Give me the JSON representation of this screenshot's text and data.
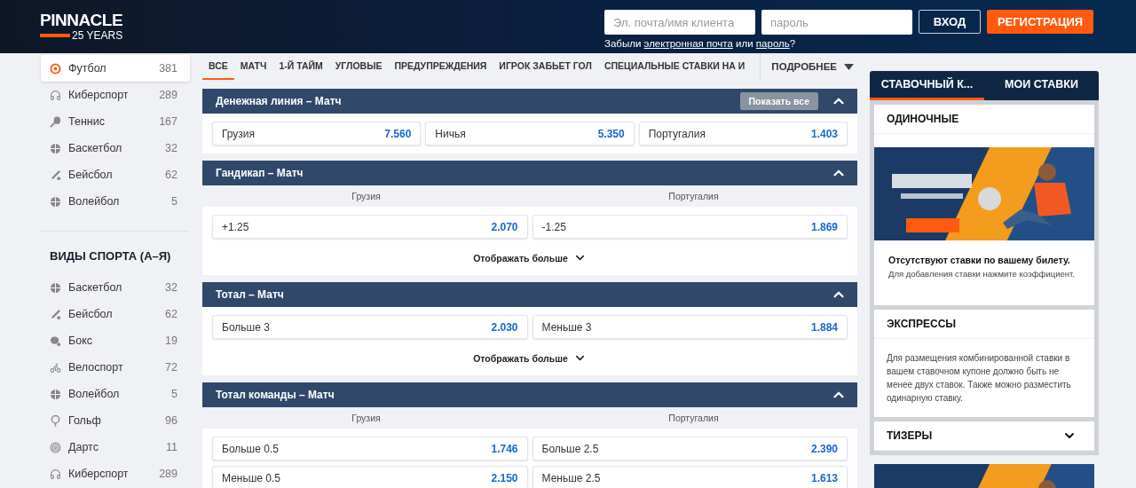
{
  "header": {
    "logo": {
      "brand": "PINNACLE",
      "tagline": "25 YEARS"
    },
    "login_field": {
      "placeholder": "Эл. почта/имя клиента"
    },
    "password_field": {
      "placeholder": "пароль"
    },
    "login_button": "ВХОД",
    "register_button": "РЕГИСТРАЦИЯ",
    "forgot": {
      "before": "Забыли",
      "link1": "электронная почта",
      "middle": "или",
      "link2": "пароль",
      "after": "?"
    }
  },
  "sidebar": {
    "top_sports": [
      {
        "kind": "football",
        "label": "Футбол",
        "count": "381",
        "selected": true
      },
      {
        "kind": "esports",
        "label": "Киберспорт",
        "count": "289",
        "selected": false
      },
      {
        "kind": "tennis",
        "label": "Теннис",
        "count": "167",
        "selected": false
      },
      {
        "kind": "basketball",
        "label": "Баскетбол",
        "count": "32",
        "selected": false
      },
      {
        "kind": "baseball",
        "label": "Бейсбол",
        "count": "62",
        "selected": false
      },
      {
        "kind": "volleyball",
        "label": "Волейбол",
        "count": "5",
        "selected": false
      }
    ],
    "az_title": "ВИДЫ СПОРТА (А–Я)",
    "az_sports": [
      {
        "kind": "basketball",
        "label": "Баскетбол",
        "count": "32",
        "selected": false
      },
      {
        "kind": "baseball",
        "label": "Бейсбол",
        "count": "62",
        "selected": false
      },
      {
        "kind": "boxing",
        "label": "Бокс",
        "count": "19",
        "selected": false
      },
      {
        "kind": "cycling",
        "label": "Велоспорт",
        "count": "72",
        "selected": false
      },
      {
        "kind": "volleyball",
        "label": "Волейбол",
        "count": "5",
        "selected": false
      },
      {
        "kind": "golf",
        "label": "Гольф",
        "count": "96",
        "selected": false
      },
      {
        "kind": "darts",
        "label": "Дартс",
        "count": "11",
        "selected": false
      },
      {
        "kind": "esports",
        "label": "Киберспорт",
        "count": "289",
        "selected": false
      }
    ]
  },
  "market_tabs": [
    {
      "label": "ВСЕ",
      "selected": true
    },
    {
      "label": "МАТЧ",
      "selected": false
    },
    {
      "label": "1-Й ТАЙМ",
      "selected": false
    },
    {
      "label": "УГЛОВЫЕ",
      "selected": false
    },
    {
      "label": "ПРЕДУПРЕЖДЕНИЯ",
      "selected": false
    },
    {
      "label": "ИГРОК ЗАБЬЕТ ГОЛ",
      "selected": false
    },
    {
      "label": "СПЕЦИАЛЬНЫЕ СТАВКИ НА И",
      "selected": false
    }
  ],
  "more_tab": "ПОДРОБНЕЕ",
  "markets": [
    {
      "title": "Денежная линия – Матч",
      "expanded": true,
      "show_all_button": "Показать все",
      "rows": [
        [
          {
            "label": "Грузия",
            "odds": "7.560"
          },
          {
            "label": "Ничья",
            "odds": "5.350"
          },
          {
            "label": "Португалия",
            "odds": "1.403"
          }
        ]
      ]
    },
    {
      "title": "Гандикап – Матч",
      "expanded": true,
      "columns": [
        "Грузия",
        "Португалия"
      ],
      "rows": [
        [
          {
            "label": "+1.25",
            "odds": "2.070"
          },
          {
            "label": "-1.25",
            "odds": "1.869"
          }
        ]
      ],
      "show_more": "Отображать больше"
    },
    {
      "title": "Тотал – Матч",
      "expanded": true,
      "rows": [
        [
          {
            "label": "Больше 3",
            "odds": "2.030"
          },
          {
            "label": "Меньше 3",
            "odds": "1.884"
          }
        ]
      ],
      "show_more": "Отображать больше"
    },
    {
      "title": "Тотал команды – Матч",
      "expanded": true,
      "columns": [
        "Грузия",
        "Португалия"
      ],
      "rows": [
        [
          {
            "label": "Больше 0.5",
            "odds": "1.746"
          },
          {
            "label": "Больше 2.5",
            "odds": "2.390"
          }
        ],
        [
          {
            "label": "Меньше 0.5",
            "odds": "2.150"
          },
          {
            "label": "Меньше 2.5",
            "odds": "1.613"
          }
        ]
      ]
    }
  ],
  "betslip": {
    "tabs": [
      {
        "label": "СТАВОЧНЫЙ К...",
        "selected": true
      },
      {
        "label": "МОИ СТАВКИ",
        "selected": false
      }
    ],
    "singles": {
      "title": "ОДИНОЧНЫЕ",
      "empty_title": "Отсутствуют ставки по вашему билету.",
      "empty_hint": "Для добавления ставки нажмите коэффициент."
    },
    "parlays": {
      "title": "ЭКСПРЕССЫ",
      "text": "Для размещения комбинированной ставки в вашем ставочном купоне должно быть не менее двух ставок. Также можно разместить одинарную ставку."
    },
    "teasers": {
      "title": "ТИЗЕРЫ",
      "expanded": false
    }
  }
}
